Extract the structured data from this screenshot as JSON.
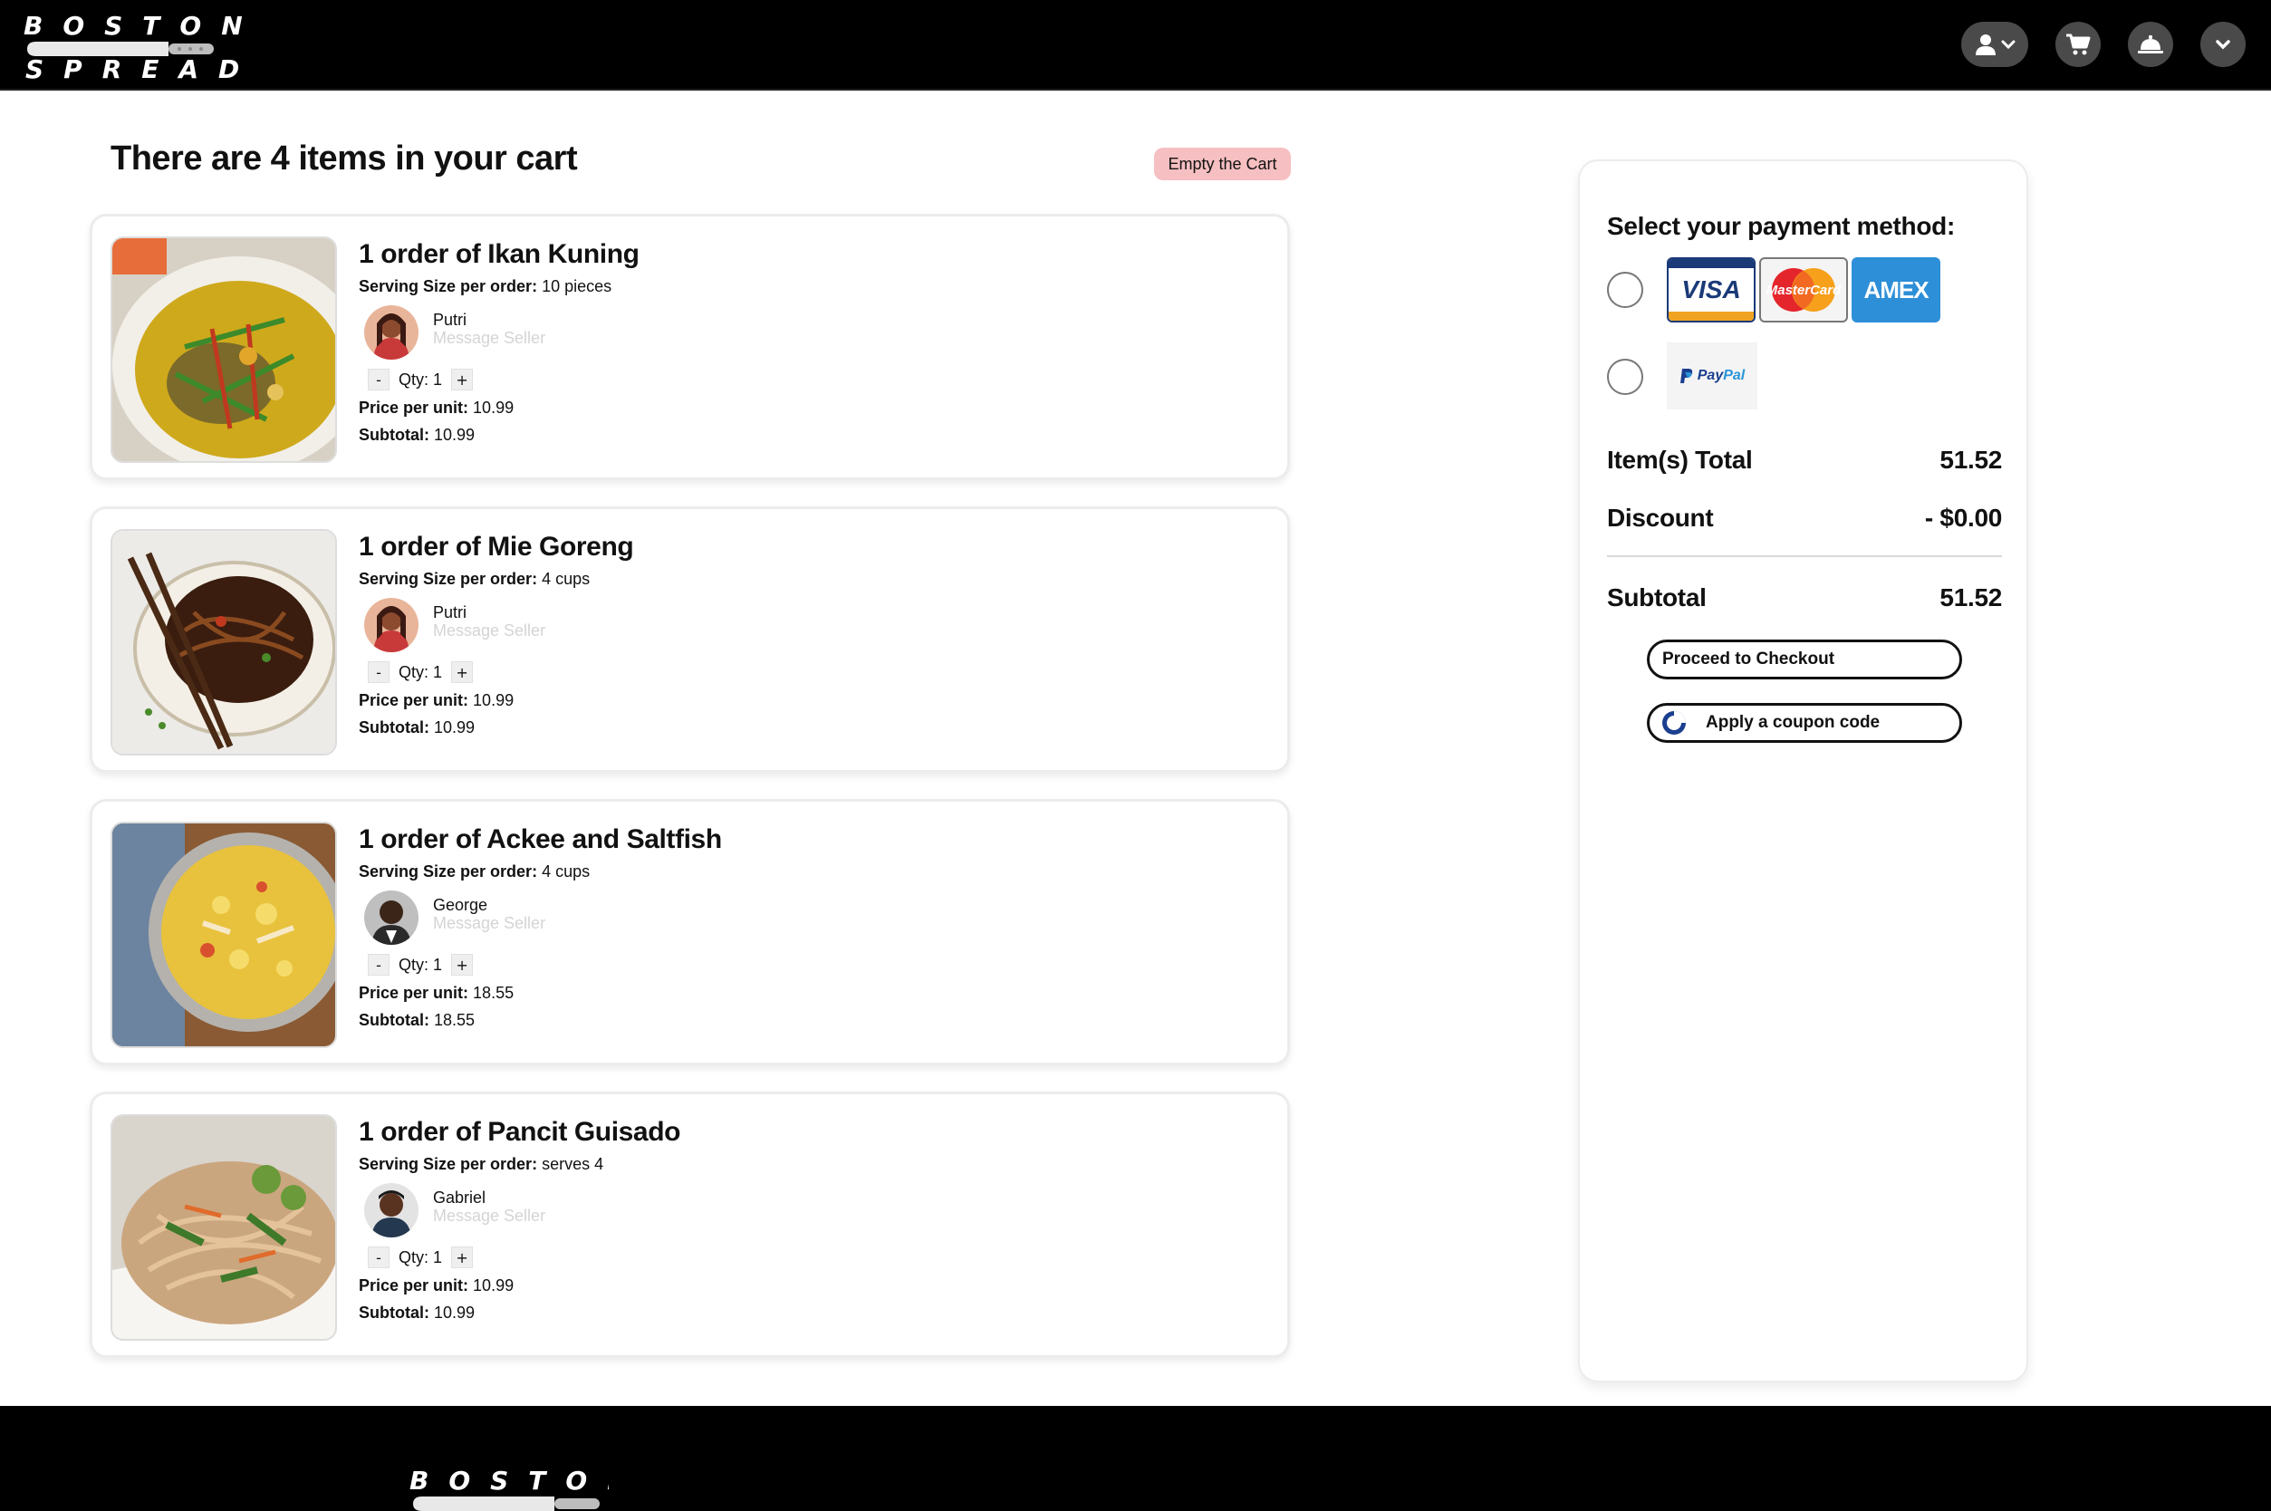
{
  "brand": {
    "line1": "BOSTON",
    "line2": "SPREAD"
  },
  "nav": {
    "icons": [
      "user-icon",
      "chevron-down-icon",
      "cart-icon",
      "service-bell-icon",
      "chevron-down-icon"
    ]
  },
  "cart": {
    "title": "There are 4 items in your cart",
    "empty_label": "Empty the Cart",
    "labels": {
      "serving": "Serving Size per order:",
      "qty": "Qty:",
      "price": "Price per unit:",
      "subtotal": "Subtotal:",
      "message": "Message Seller",
      "minus": "-",
      "plus": "+"
    },
    "items": [
      {
        "title": "1 order of Ikan Kuning",
        "serving": "10 pieces",
        "seller": "Putri",
        "qty": "1",
        "price": "10.99",
        "subtotal": "10.99"
      },
      {
        "title": "1 order of Mie Goreng",
        "serving": "4 cups",
        "seller": "Putri",
        "qty": "1",
        "price": "10.99",
        "subtotal": "10.99"
      },
      {
        "title": "1 order of Ackee and Saltfish",
        "serving": "4 cups",
        "seller": "George",
        "qty": "1",
        "price": "18.55",
        "subtotal": "18.55"
      },
      {
        "title": "1 order of Pancit Guisado",
        "serving": "serves 4",
        "seller": "Gabriel",
        "qty": "1",
        "price": "10.99",
        "subtotal": "10.99"
      }
    ]
  },
  "payment": {
    "title": "Select your payment method:",
    "card_brands": {
      "visa": "VISA",
      "mastercard": "MasterCard",
      "amex": "AMEX"
    },
    "paypal": {
      "pay": "Pay",
      "pal": "Pal"
    },
    "items_total_label": "Item(s) Total",
    "items_total_value": "51.52",
    "discount_label": "Discount",
    "discount_value": "- $0.00",
    "subtotal_label": "Subtotal",
    "subtotal_value": "51.52",
    "checkout_label": "Proceed to Checkout",
    "coupon_label": "Apply a coupon code"
  },
  "colors": {
    "header_bg": "#000000",
    "empty_btn": "#f6bfc1",
    "visa_blue": "#1a3a78",
    "amex_blue": "#2d8fd8"
  }
}
